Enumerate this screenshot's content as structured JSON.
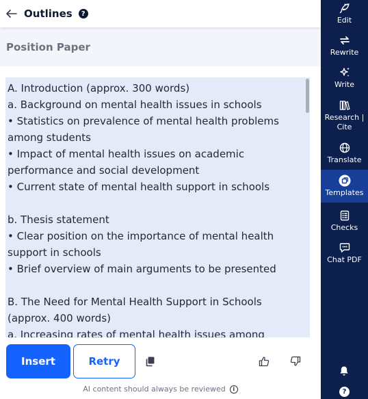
{
  "header": {
    "title": "Outlines",
    "help_glyph": "?"
  },
  "section": {
    "title": "Position Paper"
  },
  "outline": {
    "lines": [
      "A. Introduction (approx. 300 words)",
      "a. Background on mental health issues in schools",
      "• Statistics on prevalence of mental health problems among students",
      "• Impact of mental health issues on academic performance and social development",
      "• Current state of mental health support in schools",
      "",
      "b. Thesis statement",
      "• Clear position on the importance of mental health support in schools",
      "• Brief overview of main arguments to be presented",
      "",
      "B. The Need for Mental Health Support in Schools (approx. 400 words)",
      "a. Increasing rates of mental health issues among students"
    ]
  },
  "actions": {
    "insert_label": "Insert",
    "retry_label": "Retry"
  },
  "footer": {
    "disclaimer": "AI content should always be reviewed",
    "info_glyph": "i"
  },
  "sidebar": {
    "items": [
      {
        "label": "Edit",
        "icon": "feather-icon"
      },
      {
        "label": "Rewrite",
        "icon": "arrows-swap-icon"
      },
      {
        "label": "Write",
        "icon": "sparkles-icon"
      },
      {
        "label": "Research | Cite",
        "icon": "books-icon"
      },
      {
        "label": "Translate",
        "icon": "globe-icon"
      },
      {
        "label": "Templates",
        "icon": "templates-icon",
        "active": true
      },
      {
        "label": "Checks",
        "icon": "checklist-icon"
      },
      {
        "label": "Chat PDF",
        "icon": "chat-icon"
      }
    ],
    "help_glyph": "?"
  },
  "colors": {
    "accent": "#1463ff",
    "sidebar_bg": "#0c1f4d",
    "sidebar_active": "#173f97",
    "outline_bg": "#e4eaf8"
  }
}
